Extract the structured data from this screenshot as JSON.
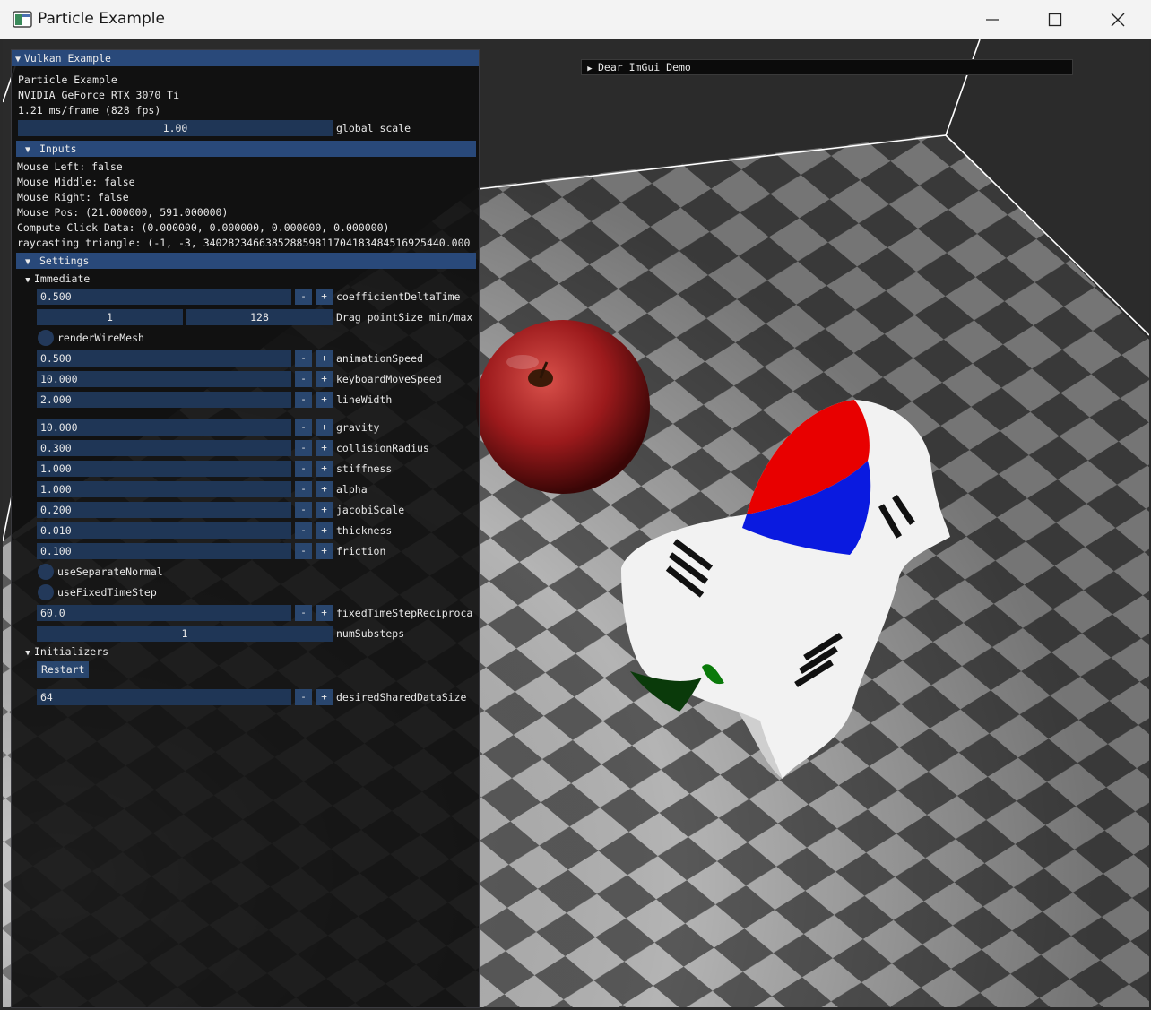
{
  "window": {
    "title": "Particle Example"
  },
  "vulkan_panel": {
    "header": "Vulkan Example",
    "app_name": "Particle Example",
    "gpu": "NVIDIA GeForce RTX 3070 Ti",
    "frame_time": "1.21 ms/frame (828 fps)",
    "global_scale": {
      "value": "1.00",
      "label": "global scale"
    },
    "inputs": {
      "header": "Inputs",
      "lines": [
        "Mouse Left: false",
        "Mouse Middle: false",
        "Mouse Right: false",
        "Mouse Pos: (21.000000, 591.000000)",
        "Compute Click Data: (0.000000, 0.000000, 0.000000, 0.000000)",
        "raycasting triangle: (-1, -3, 340282346638528859811704183484516925440.000"
      ]
    },
    "settings": {
      "header": "Settings",
      "immediate": {
        "header": "Immediate",
        "coefficient_delta_time": {
          "value": "0.500",
          "label": "coefficientDeltaTime"
        },
        "point_size": {
          "min": "1",
          "max": "128",
          "label": "Drag pointSize min/max"
        },
        "render_wire_mesh": {
          "label": "renderWireMesh"
        },
        "animation_speed": {
          "value": "0.500",
          "label": "animationSpeed"
        },
        "keyboard_move_speed": {
          "value": "10.000",
          "label": "keyboardMoveSpeed"
        },
        "line_width": {
          "value": "2.000",
          "label": "lineWidth"
        },
        "gravity": {
          "value": "10.000",
          "label": "gravity"
        },
        "collision_radius": {
          "value": "0.300",
          "label": "collisionRadius"
        },
        "stiffness": {
          "value": "1.000",
          "label": "stiffness"
        },
        "alpha": {
          "value": "1.000",
          "label": "alpha"
        },
        "jacobi_scale": {
          "value": "0.200",
          "label": "jacobiScale"
        },
        "thickness": {
          "value": "0.010",
          "label": "thickness"
        },
        "friction": {
          "value": "0.100",
          "label": "friction"
        },
        "use_separate_normal": {
          "label": "useSeparateNormal"
        },
        "use_fixed_time_step": {
          "label": "useFixedTimeStep"
        },
        "fixed_time_step_reciprocal": {
          "value": "60.0",
          "label": "fixedTimeStepReciproca"
        },
        "num_substeps": {
          "value": "1",
          "label": "numSubsteps"
        },
        "minus": "-",
        "plus": "+"
      },
      "initializers": {
        "header": "Initializers",
        "restart_label": "Restart",
        "desired_shared_data_size": {
          "value": "64",
          "label": "desiredSharedDataSize"
        }
      }
    }
  },
  "demo_window": {
    "title": "Dear ImGui Demo"
  },
  "colors": {
    "header_blue": "#29497a",
    "field_blue": "#1f3656",
    "button_blue": "#29466e",
    "panel_bg": "#0e0e0e"
  }
}
